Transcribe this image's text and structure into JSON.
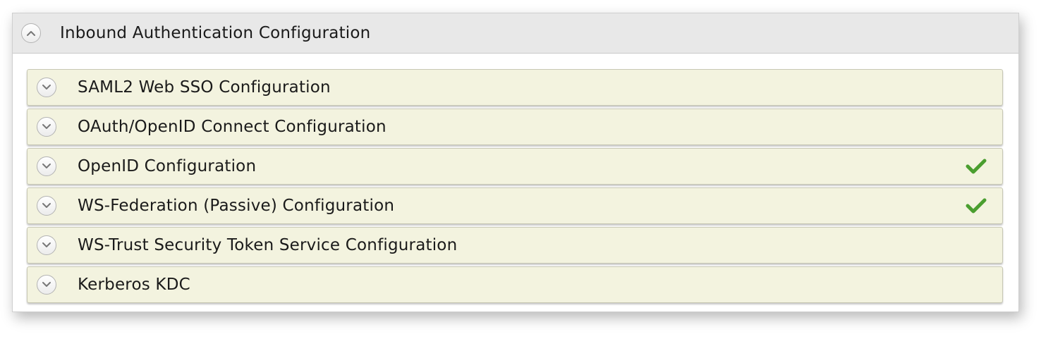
{
  "panel": {
    "title": "Inbound Authentication Configuration",
    "expanded_icon": "chevron-up-icon"
  },
  "sections": [
    {
      "label": "SAML2 Web SSO Configuration",
      "configured": false,
      "icon": "chevron-down-icon"
    },
    {
      "label": "OAuth/OpenID Connect Configuration",
      "configured": false,
      "icon": "chevron-down-icon"
    },
    {
      "label": "OpenID Configuration",
      "configured": true,
      "icon": "chevron-down-icon"
    },
    {
      "label": "WS-Federation (Passive) Configuration",
      "configured": true,
      "icon": "chevron-down-icon"
    },
    {
      "label": "WS-Trust Security Token Service Configuration",
      "configured": false,
      "icon": "chevron-down-icon"
    },
    {
      "label": "Kerberos KDC",
      "configured": false,
      "icon": "chevron-down-icon"
    }
  ],
  "colors": {
    "header_bg": "#e8e8e8",
    "section_bg": "#f3f3df",
    "check_green": "#4a9e2f"
  }
}
